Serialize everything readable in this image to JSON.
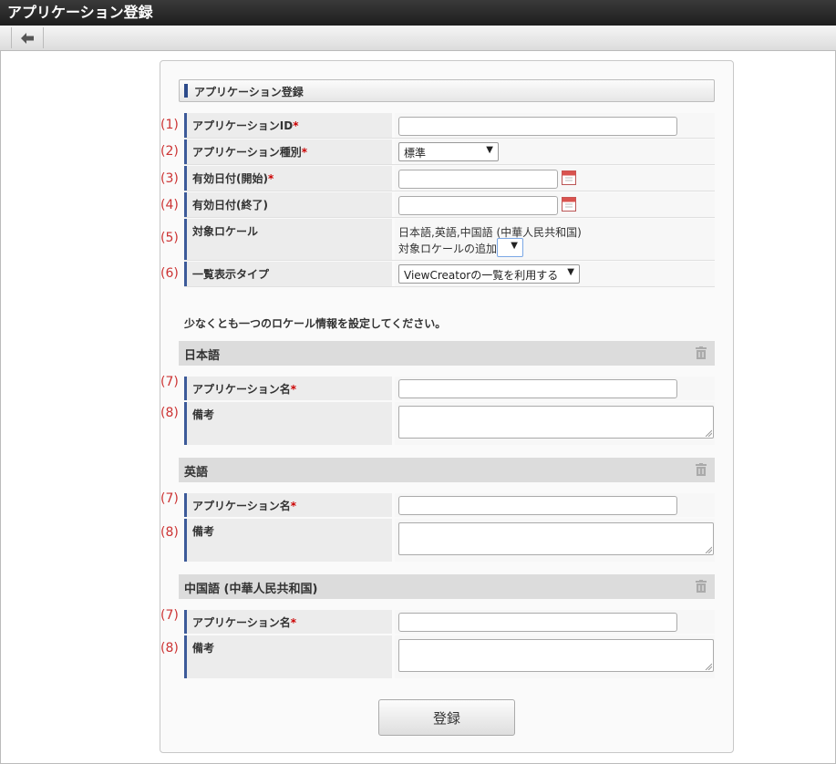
{
  "window": {
    "title": "アプリケーション登録"
  },
  "toolbar": {
    "back_icon": "arrow-left-icon"
  },
  "section": {
    "title": "アプリケーション登録"
  },
  "fields": [
    {
      "num": "(1)",
      "label": "アプリケーションID",
      "required": "*",
      "value": ""
    },
    {
      "num": "(2)",
      "label": "アプリケーション種別",
      "required": "*",
      "value": "標準"
    },
    {
      "num": "(3)",
      "label": "有効日付(開始)",
      "required": "*",
      "value": ""
    },
    {
      "num": "(4)",
      "label": "有効日付(終了)",
      "required": "",
      "value": ""
    },
    {
      "num": "(5)",
      "label": "対象ロケール",
      "required": "",
      "value": "日本語,英語,中国語 (中華人民共和国)",
      "add_label": "対象ロケールの追加"
    },
    {
      "num": "(6)",
      "label": "一覧表示タイプ",
      "required": "",
      "value": "ViewCreatorの一覧を利用する"
    }
  ],
  "note": "少なくとも一つのロケール情報を設定してください。",
  "locales": [
    {
      "name": "日本語",
      "name_label": "アプリケーション名",
      "name_num": "(7)",
      "memo_label": "備考",
      "memo_num": "(8)",
      "required": "*"
    },
    {
      "name": "英語",
      "name_label": "アプリケーション名",
      "name_num": "(7)",
      "memo_label": "備考",
      "memo_num": "(8)",
      "required": "*"
    },
    {
      "name": "中国語 (中華人民共和国)",
      "name_label": "アプリケーション名",
      "name_num": "(7)",
      "memo_label": "備考",
      "memo_num": "(8)",
      "required": "*"
    }
  ],
  "submit_label": "登録",
  "colors": {
    "accent": "#3c5a99",
    "required": "#cc0000",
    "number": "#cc3333"
  }
}
